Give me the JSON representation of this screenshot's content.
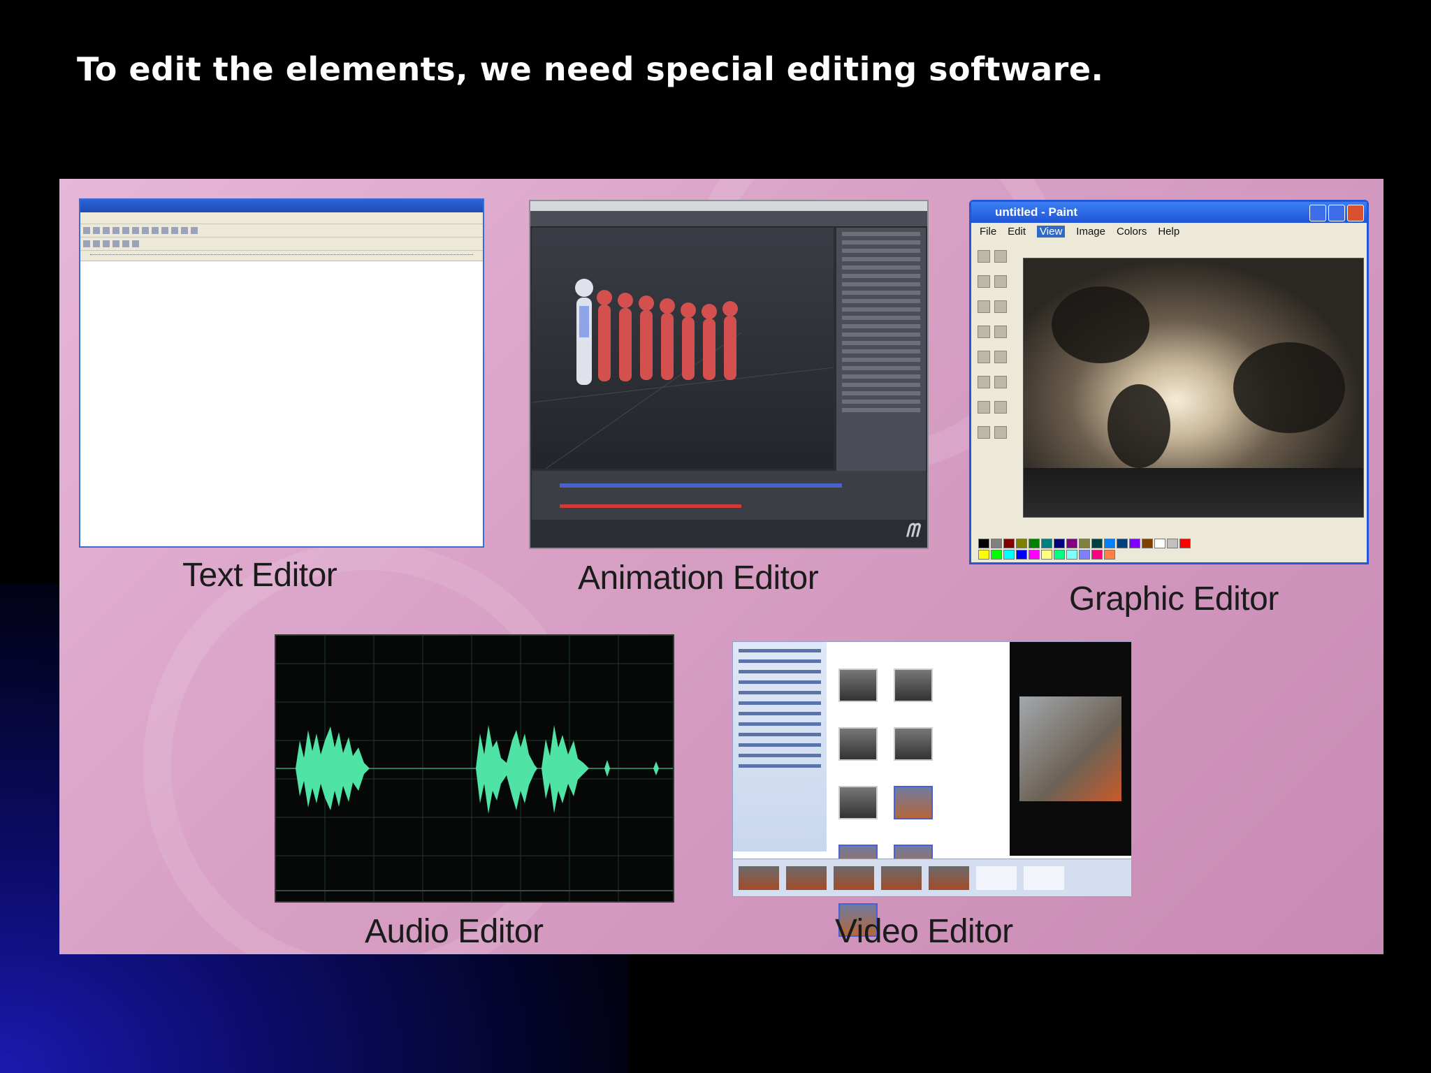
{
  "slide": {
    "title": "To edit the elements, we need special editing software."
  },
  "editors": {
    "text": {
      "caption": "Text Editor"
    },
    "animation": {
      "caption": "Animation Editor"
    },
    "graphic": {
      "caption": "Graphic Editor"
    },
    "audio": {
      "caption": "Audio Editor"
    },
    "video": {
      "caption": "Video Editor"
    }
  },
  "screenshots": {
    "paint": {
      "window_title": "untitled - Paint",
      "menu": [
        "File",
        "Edit",
        "View",
        "Image",
        "Colors",
        "Help"
      ],
      "active_menu": "View",
      "palette": [
        "#000000",
        "#808080",
        "#800000",
        "#808000",
        "#008000",
        "#008080",
        "#000080",
        "#800080",
        "#808040",
        "#004040",
        "#0080ff",
        "#004080",
        "#8000ff",
        "#804000",
        "#ffffff",
        "#c0c0c0",
        "#ff0000",
        "#ffff00",
        "#00ff00",
        "#00ffff",
        "#0000ff",
        "#ff00ff",
        "#ffff80",
        "#00ff80",
        "#80ffff",
        "#8080ff",
        "#ff0080",
        "#ff8040"
      ]
    },
    "audio": {
      "waveform_color": "#4fe3a6"
    }
  }
}
